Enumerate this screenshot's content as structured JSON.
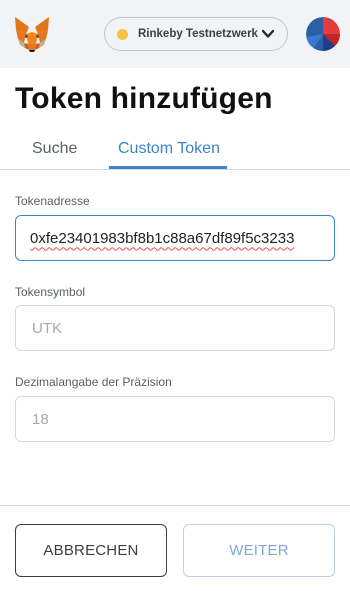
{
  "header": {
    "logo_icon": "metamask-fox-icon",
    "network_label": "Rinkeby Testnetzwerk",
    "network_status_color": "#f6c343",
    "network_dropdown_icon": "chevron-down-icon",
    "account_icon": "account-identicon"
  },
  "page": {
    "title": "Token hinzufügen"
  },
  "tabs": [
    {
      "label": "Suche",
      "active": false
    },
    {
      "label": "Custom Token",
      "active": true
    }
  ],
  "form": {
    "token_address": {
      "label": "Tokenadresse",
      "value": "0xfe23401983bf8b1c88a67df89f5c3233"
    },
    "token_symbol": {
      "label": "Tokensymbol",
      "placeholder": "UTK",
      "value": ""
    },
    "decimals": {
      "label": "Dezimalangabe der Präzision",
      "placeholder": "18",
      "value": ""
    }
  },
  "actions": {
    "cancel_label": "ABBRECHEN",
    "next_label": "WEITER"
  },
  "colors": {
    "accent": "#3d84c6",
    "header_bg": "#f2f3f4"
  }
}
